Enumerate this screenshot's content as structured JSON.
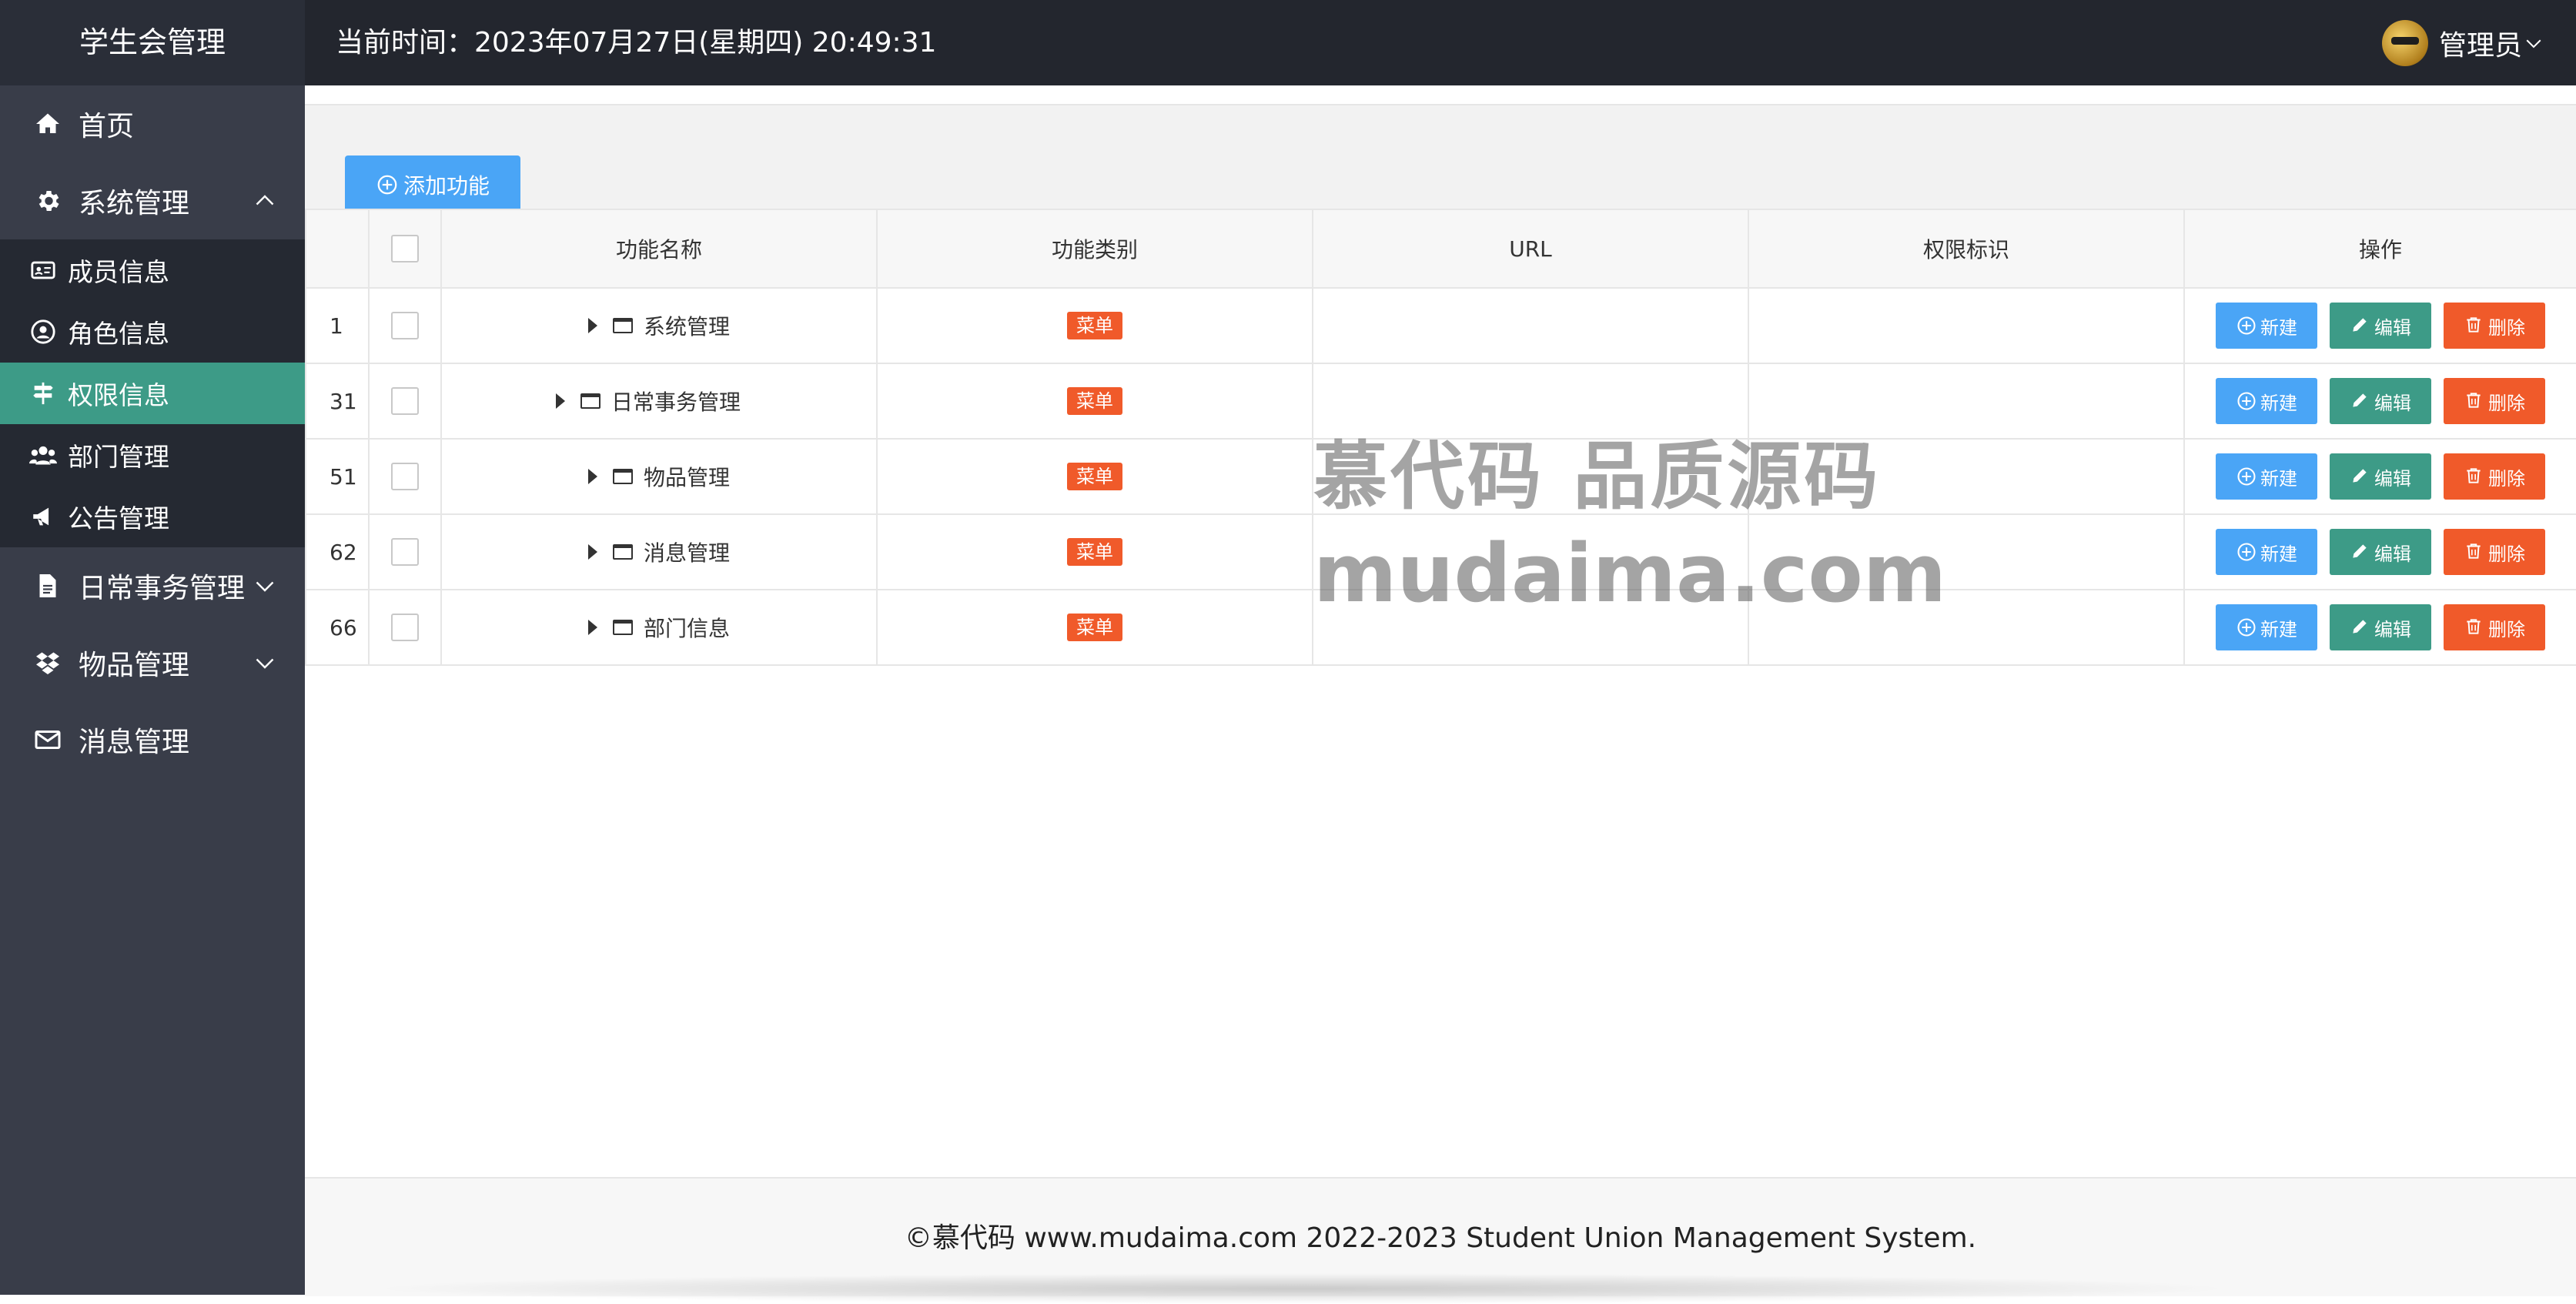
{
  "brand": "学生会管理",
  "header": {
    "clock": "当前时间：2023年07月27日(星期四) 20:49:31",
    "user_name": "管理员"
  },
  "sidebar": {
    "items": [
      {
        "label": "首页",
        "icon": "home-icon"
      },
      {
        "label": "系统管理",
        "icon": "gear-icon",
        "expanded": true,
        "children": [
          {
            "label": "成员信息",
            "icon": "id-card-icon"
          },
          {
            "label": "角色信息",
            "icon": "user-circle-icon"
          },
          {
            "label": "权限信息",
            "icon": "signpost-icon",
            "active": true
          },
          {
            "label": "部门管理",
            "icon": "users-icon"
          },
          {
            "label": "公告管理",
            "icon": "bullhorn-icon"
          }
        ]
      },
      {
        "label": "日常事务管理",
        "icon": "file-icon",
        "expanded": false
      },
      {
        "label": "物品管理",
        "icon": "dropbox-icon",
        "expanded": false
      },
      {
        "label": "消息管理",
        "icon": "envelope-icon"
      }
    ]
  },
  "toolbar": {
    "add_label": "添加功能"
  },
  "table": {
    "columns": [
      "",
      "",
      "功能名称",
      "功能类别",
      "URL",
      "权限标识",
      "操作"
    ],
    "rows": [
      {
        "id": "1",
        "name": "系统管理",
        "type": "菜单",
        "url": "",
        "perm": ""
      },
      {
        "id": "31",
        "name": "日常事务管理",
        "type": "菜单",
        "url": "",
        "perm": ""
      },
      {
        "id": "51",
        "name": "物品管理",
        "type": "菜单",
        "url": "",
        "perm": ""
      },
      {
        "id": "62",
        "name": "消息管理",
        "type": "菜单",
        "url": "",
        "perm": ""
      },
      {
        "id": "66",
        "name": "部门信息",
        "type": "菜单",
        "url": "",
        "perm": ""
      }
    ],
    "actions": {
      "new": "新建",
      "edit": "编辑",
      "delete": "删除"
    }
  },
  "watermark": {
    "line1": "慕代码 品质源码",
    "line2": "mudaima.com"
  },
  "footer": {
    "text": "©慕代码 www.mudaima.com 2022-2023 Student Union Management System."
  },
  "colors": {
    "sidebar": "#393d49",
    "header": "#23262e",
    "active": "#3d9b87",
    "primary": "#4aa5f6",
    "danger": "#f05a2a"
  }
}
